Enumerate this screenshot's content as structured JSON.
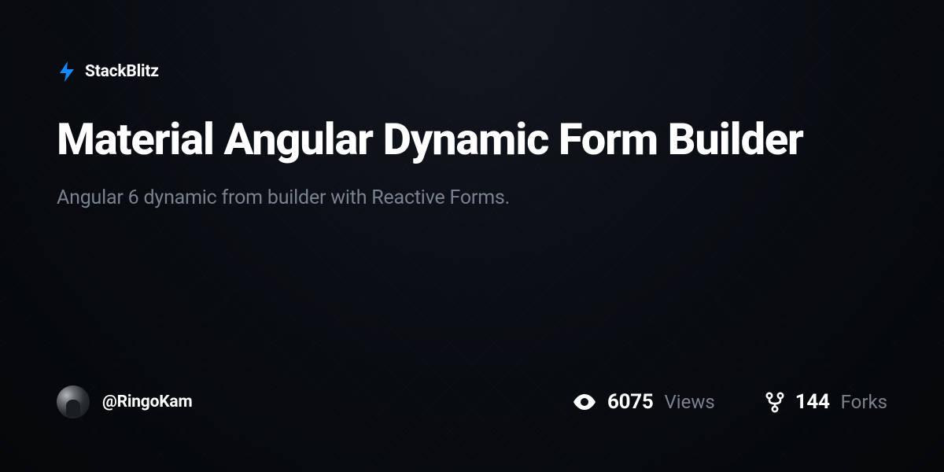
{
  "brand": {
    "name": "StackBlitz",
    "accent_color": "#1389fd"
  },
  "project": {
    "title": "Material Angular Dynamic Form Builder",
    "description": "Angular 6 dynamic from builder with Reactive Forms."
  },
  "author": {
    "username": "@RingoKam"
  },
  "stats": {
    "views": {
      "value": "6075",
      "label": "Views"
    },
    "forks": {
      "value": "144",
      "label": "Forks"
    }
  }
}
